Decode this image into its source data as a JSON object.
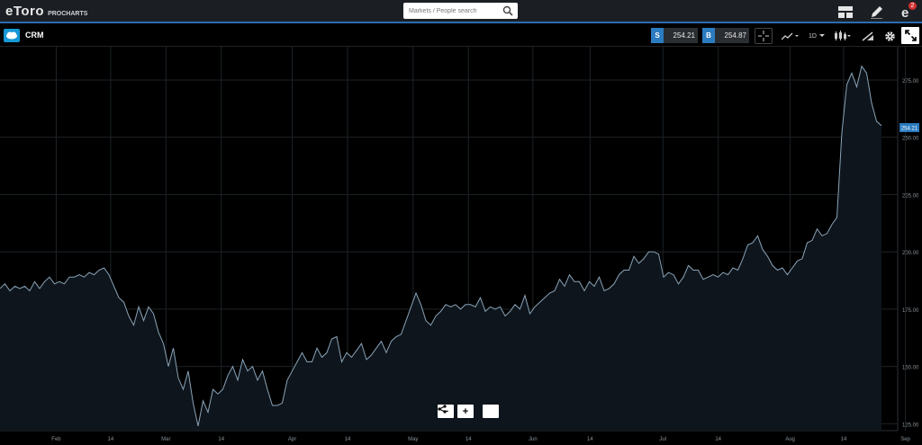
{
  "nav": {
    "brand": "eToro",
    "sub": "PROCHARTS",
    "search_placeholder": "Markets / People search",
    "notification_count": "2"
  },
  "toolbar": {
    "symbol": "CRM",
    "sell_label": "S",
    "sell_price": "254.21",
    "buy_label": "B",
    "buy_price": "254.87",
    "interval": "1D"
  },
  "zoom": {
    "minus": "−",
    "plus": "+"
  },
  "colors": {
    "accent": "#2b7bc0",
    "line": "#8aa3b8",
    "area": "#0e151c",
    "grid": "#1c2328"
  },
  "chart_data": {
    "type": "area",
    "symbol": "CRM",
    "last_price": 254.21,
    "ylim": [
      122,
      284
    ],
    "y_ticks": [
      125,
      150,
      175,
      200,
      225,
      250,
      275
    ],
    "y_tick_labels": [
      "125.00",
      "150.00",
      "175.00",
      "200.00",
      "225.00",
      "250.00",
      "275.00"
    ],
    "x_labels": [
      {
        "label": "Feb",
        "t": 0.061
      },
      {
        "label": "14",
        "t": 0.12
      },
      {
        "label": "Mar",
        "t": 0.18
      },
      {
        "label": "14",
        "t": 0.24
      },
      {
        "label": "Apr",
        "t": 0.317
      },
      {
        "label": "14",
        "t": 0.377
      },
      {
        "label": "May",
        "t": 0.448
      },
      {
        "label": "14",
        "t": 0.508
      },
      {
        "label": "Jun",
        "t": 0.578
      },
      {
        "label": "14",
        "t": 0.64
      },
      {
        "label": "Jul",
        "t": 0.719
      },
      {
        "label": "14",
        "t": 0.779
      },
      {
        "label": "Aug",
        "t": 0.857
      },
      {
        "label": "14",
        "t": 0.915
      },
      {
        "label": "Sep",
        "t": 0.982
      }
    ],
    "grid": true,
    "values": [
      184,
      186,
      183,
      185,
      184,
      185,
      183,
      187,
      184,
      187,
      189,
      186,
      187,
      186,
      189,
      189,
      190,
      189,
      191,
      190,
      192,
      193,
      190,
      185,
      180,
      178,
      172,
      168,
      176,
      170,
      176,
      173,
      165,
      160,
      150,
      158,
      145,
      140,
      148,
      134,
      124,
      135,
      130,
      140,
      138,
      140,
      146,
      150,
      144,
      153,
      148,
      150,
      144,
      148,
      140,
      133,
      133,
      134,
      144,
      148,
      152,
      156,
      152,
      152,
      158,
      154,
      156,
      162,
      163,
      152,
      156,
      154,
      157,
      160,
      153,
      155,
      158,
      161,
      156,
      161,
      163,
      164,
      170,
      176,
      182,
      177,
      170,
      168,
      172,
      174,
      177,
      176,
      177,
      175,
      177,
      177,
      176,
      180,
      174,
      176,
      175,
      176,
      172,
      174,
      177,
      175,
      181,
      173,
      176,
      178,
      180,
      182,
      183,
      188,
      185,
      190,
      187,
      187,
      183,
      187,
      185,
      189,
      183,
      184,
      186,
      190,
      192,
      192,
      198,
      195,
      197,
      200,
      200,
      199,
      189,
      191,
      190,
      186,
      189,
      194,
      192,
      192,
      188,
      189,
      190,
      189,
      191,
      190,
      193,
      192,
      197,
      203,
      204,
      207,
      201,
      198,
      194,
      192,
      193,
      190,
      193,
      196,
      197,
      204,
      205,
      210,
      207,
      208,
      212,
      215,
      252,
      273,
      278,
      272,
      281,
      278,
      265,
      257,
      255
    ]
  }
}
